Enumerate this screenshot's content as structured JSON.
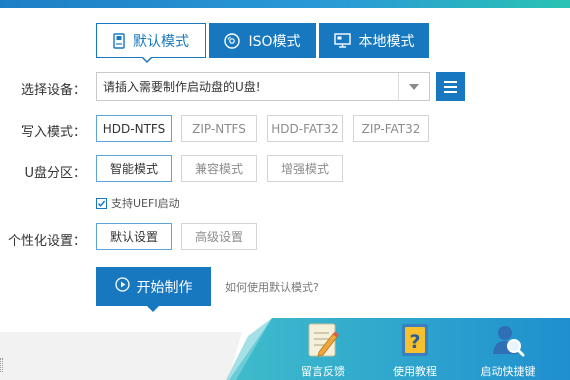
{
  "tabs": [
    {
      "label": "默认模式",
      "icon": "usb-drive-icon",
      "active": true
    },
    {
      "label": "ISO模式",
      "icon": "disc-icon",
      "active": false
    },
    {
      "label": "本地模式",
      "icon": "monitor-icon",
      "active": false
    }
  ],
  "device": {
    "label": "选择设备：",
    "value": "请插入需要制作启动盘的U盘!"
  },
  "write_mode": {
    "label": "写入模式：",
    "options": [
      "HDD-NTFS",
      "ZIP-NTFS",
      "HDD-FAT32",
      "ZIP-FAT32"
    ],
    "selected": "HDD-NTFS"
  },
  "partition": {
    "label": "U盘分区：",
    "options": [
      "智能模式",
      "兼容模式",
      "增强模式"
    ],
    "selected": "智能模式"
  },
  "uefi": {
    "label": "支持UEFI启动",
    "checked": true
  },
  "personalize": {
    "label": "个性化设置：",
    "options": [
      "默认设置",
      "高级设置"
    ],
    "selected": "默认设置"
  },
  "start_button": {
    "label": "开始制作",
    "icon": "play-circle-icon"
  },
  "help_link": "如何使用默认模式?",
  "footer": [
    {
      "label": "留言反馈",
      "icon": "pencil-note-icon"
    },
    {
      "label": "使用教程",
      "icon": "question-book-icon"
    },
    {
      "label": "启动快捷键",
      "icon": "user-search-icon"
    }
  ],
  "colors": {
    "accent": "#1778c0",
    "banner_teal": "#33b6c4"
  }
}
